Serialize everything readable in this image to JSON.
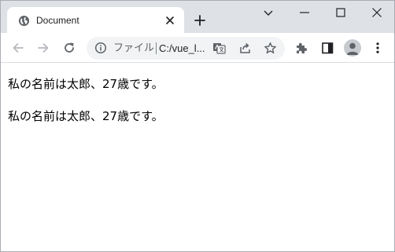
{
  "tab": {
    "title": "Document",
    "favicon": "globe-icon"
  },
  "window_controls": [
    "tab-search-icon",
    "minimize-icon",
    "maximize-icon",
    "close-icon"
  ],
  "toolbar": {
    "icons": [
      "back-arrow-icon",
      "forward-arrow-icon",
      "reload-icon",
      "extensions-icon",
      "side-panel-icon",
      "profile-avatar",
      "menu-icon"
    ]
  },
  "omnibox": {
    "scheme_label": "ファイル",
    "url": "C:/vue_l...",
    "icons": [
      "info-icon",
      "translate-icon",
      "share-icon",
      "bookmark-star-icon"
    ]
  },
  "page": {
    "paragraphs": [
      "私の名前は太郎、27歳です。",
      "私の名前は太郎、27歳です。"
    ]
  },
  "colors": {
    "tabstrip_bg": "#dee1e6",
    "omnibox_bg": "#f1f3f4",
    "icon_gray": "#5f6368",
    "text": "#000000"
  }
}
